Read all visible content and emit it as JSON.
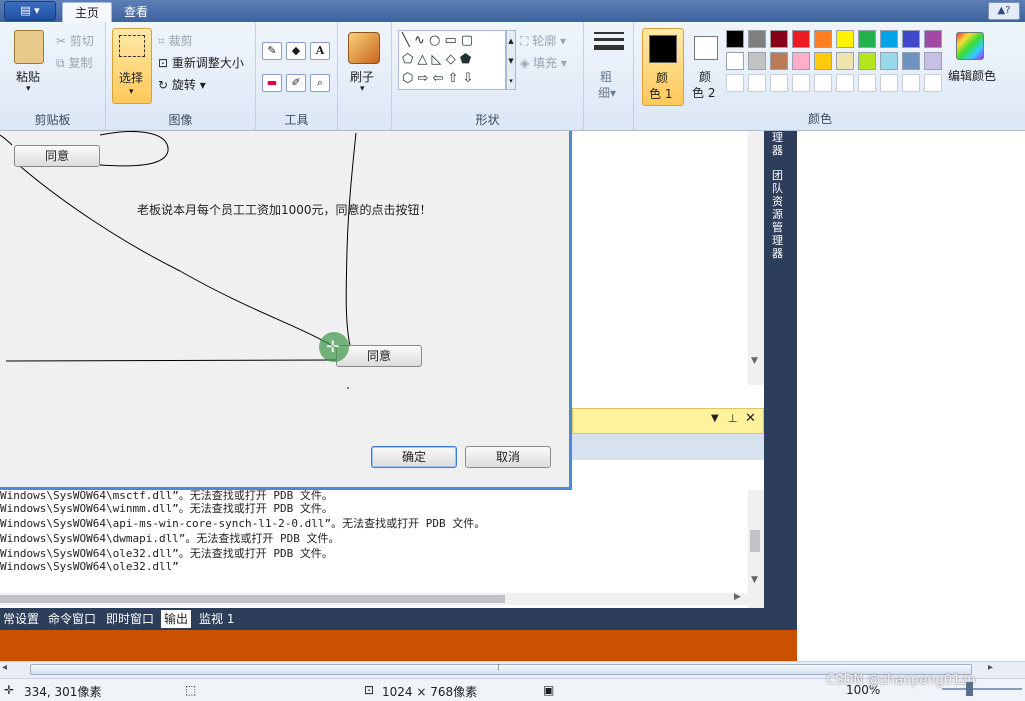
{
  "ribbon": {
    "tabs": [
      {
        "label": "主页"
      },
      {
        "label": "查看"
      }
    ],
    "clipboard": {
      "paste": "粘贴",
      "cut": "剪切",
      "copy": "复制",
      "group": "剪贴板"
    },
    "image": {
      "select": "选择",
      "crop": "裁剪",
      "resize": "重新调整大小",
      "rotate": "旋转",
      "group": "图像"
    },
    "tools": {
      "group": "工具",
      "text_tool": "A"
    },
    "brush": {
      "label": "刷子"
    },
    "shapes": {
      "outline": "轮廓",
      "fill": "填充",
      "group": "形状"
    },
    "size": {
      "label1": "粗",
      "label2": "细"
    },
    "color1": {
      "label1": "颜",
      "label2": "色 1"
    },
    "color2": {
      "label1": "颜",
      "label2": "色 2"
    },
    "colors": {
      "group": "颜色",
      "edit": "编辑颜色"
    },
    "palette_row1": [
      "#000000",
      "#7f7f7f",
      "#880015",
      "#ed1c24",
      "#ff7f27",
      "#fff200",
      "#22b14c",
      "#00a2e8",
      "#3f48cc",
      "#a349a4"
    ],
    "palette_row2": [
      "#ffffff",
      "#c3c3c3",
      "#b97a57",
      "#ffaec9",
      "#ffc90e",
      "#efe4b0",
      "#b5e61d",
      "#99d9ea",
      "#7092be",
      "#c8bfe7"
    ],
    "palette_row3": [
      "#ffffff",
      "#ffffff",
      "#ffffff",
      "#ffffff",
      "#ffffff",
      "#ffffff",
      "#ffffff",
      "#ffffff",
      "#ffffff",
      "#ffffff"
    ]
  },
  "dialog": {
    "top_button": "同意",
    "message": "老板说本月每个员工工资加1000元，同意的点击按钮！",
    "moved_button": "同意",
    "ok": "确定",
    "cancel": "取消"
  },
  "vs": {
    "vertical_label1": "理器",
    "vertical_label2": "团队资源管理器"
  },
  "output": {
    "lines": [
      "Windows\\SysWOW64\\msctf.dll”。无法查找或打开 PDB 文件。",
      "Windows\\SysWOW64\\winmm.dll”。无法查找或打开 PDB 文件。",
      "Windows\\SysWOW64\\api-ms-win-core-synch-l1-2-0.dll”。无法查找或打开 PDB 文件。",
      "Windows\\SysWOW64\\dwmapi.dll”。无法查找或打开 PDB 文件。",
      "Windows\\SysWOW64\\ole32.dll”。无法查找或打开 PDB 文件。",
      "Windows\\SysWOW64\\ole32.dll”"
    ]
  },
  "bottom_tabs": [
    {
      "label": "常设置"
    },
    {
      "label": "命令窗口"
    },
    {
      "label": "即时窗口"
    },
    {
      "label": "输出"
    },
    {
      "label": "监视 1"
    }
  ],
  "status": {
    "coords": "334, 301像素",
    "size": "1024 × 768像素",
    "zoom": "100%",
    "watermark": "CSDN @zhaopeng01zp"
  }
}
